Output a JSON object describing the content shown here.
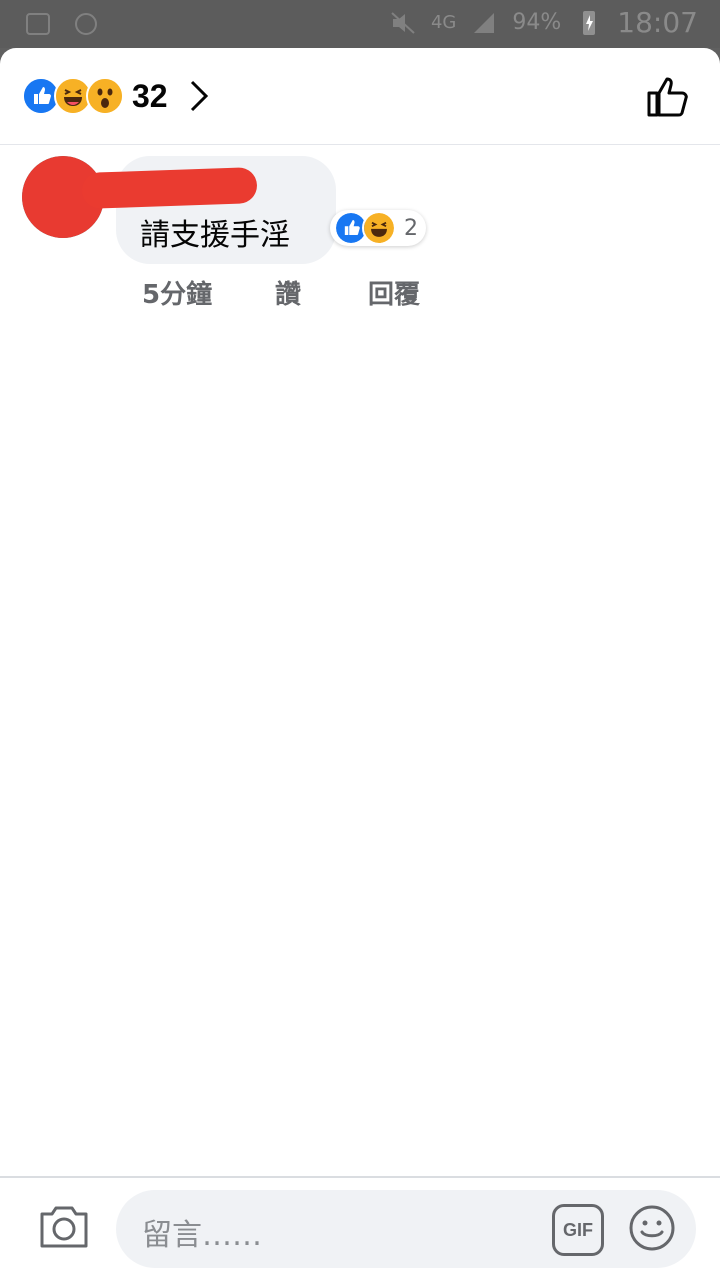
{
  "status_bar": {
    "network": "4G",
    "battery": "94%",
    "time": "18:07"
  },
  "header": {
    "reaction_icons": [
      "like-icon",
      "haha-icon",
      "wow-icon"
    ],
    "reaction_count": "32"
  },
  "comment": {
    "text": "請支援手淫",
    "reaction_icons": [
      "like-icon",
      "haha-icon"
    ],
    "reaction_count": "2",
    "time": "5分鐘",
    "like_label": "讚",
    "reply_label": "回覆"
  },
  "composer": {
    "placeholder": "留言……",
    "gif_label": "GIF"
  },
  "colors": {
    "like_blue": "#1877f2",
    "haha_yellow": "#f7b125",
    "text_secondary": "#65676b",
    "bubble_bg": "#f0f2f5"
  }
}
